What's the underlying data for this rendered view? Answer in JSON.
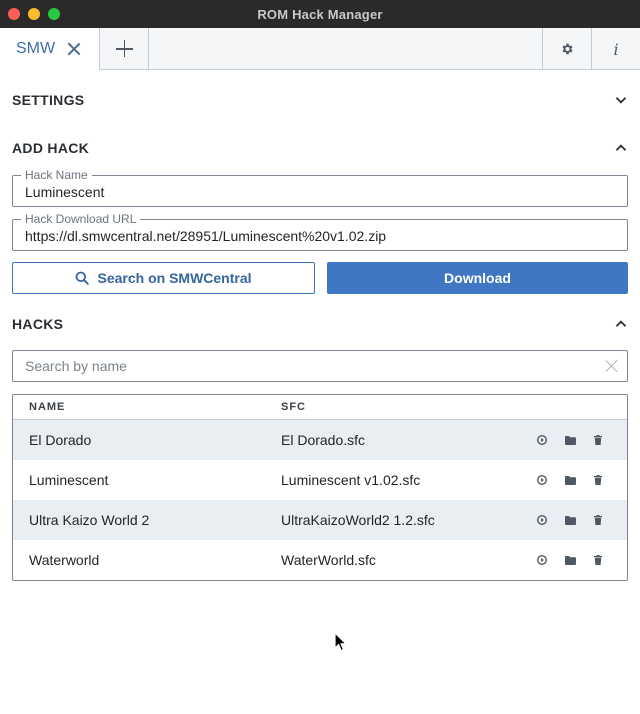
{
  "window": {
    "title": "ROM Hack Manager"
  },
  "tabs": {
    "active": {
      "label": "SMW"
    }
  },
  "sections": {
    "settings": {
      "title": "SETTINGS"
    },
    "add_hack": {
      "title": "ADD HACK",
      "hack_name": {
        "label": "Hack Name",
        "value": "Luminescent"
      },
      "download_url": {
        "label": "Hack Download URL",
        "value": "https://dl.smwcentral.net/28951/Luminescent%20v1.02.zip"
      },
      "search_button": "Search on SMWCentral",
      "download_button": "Download"
    },
    "hacks": {
      "title": "HACKS",
      "search_placeholder": "Search by name",
      "columns": {
        "name": "NAME",
        "sfc": "SFC"
      },
      "rows": [
        {
          "name": "El Dorado",
          "sfc": "El Dorado.sfc"
        },
        {
          "name": "Luminescent",
          "sfc": "Luminescent v1.02.sfc"
        },
        {
          "name": "Ultra Kaizo World 2",
          "sfc": "UltraKaizoWorld2 1.2.sfc"
        },
        {
          "name": "Waterworld",
          "sfc": "WaterWorld.sfc"
        }
      ]
    }
  },
  "icons": {
    "tab_close": "close-icon",
    "tab_add": "plus-icon",
    "settings": "gear-icon",
    "info": "info-icon",
    "info_glyph": "i",
    "row_play": "play-icon",
    "row_folder": "folder-icon",
    "row_delete": "trash-icon"
  },
  "colors": {
    "accent": "#3f77c2",
    "tab_active_text": "#3f6ea2",
    "row_alt": "#e9eef3",
    "titlebar": "#2a2a2a"
  }
}
